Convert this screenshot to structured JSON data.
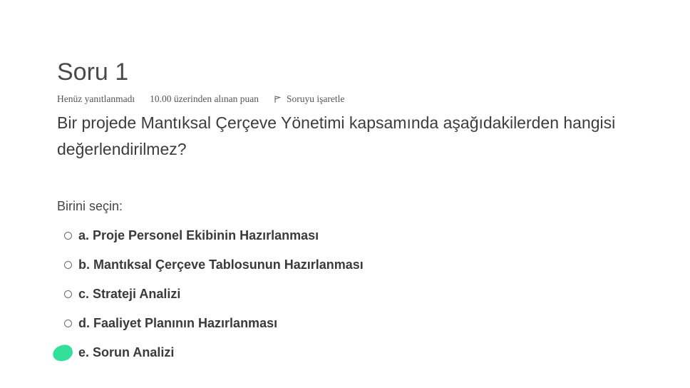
{
  "question": {
    "title": "Soru 1",
    "state": "Henüz yanıtlanmadı",
    "grade": "10.00 üzerinden alınan puan",
    "flag_label": "Soruyu işaretle",
    "text": "Bir projede Mantıksal Çerçeve Yönetimi kapsamında aşağıdakilerden hangisi değerlendirilmez?",
    "prompt": "Birini seçin:",
    "options": [
      {
        "label": "a. Proje Personel Ekibinin Hazırlanması",
        "selected": false
      },
      {
        "label": "b. Mantıksal Çerçeve Tablosunun Hazırlanması",
        "selected": false
      },
      {
        "label": "c. Strateji Analizi",
        "selected": false
      },
      {
        "label": "d. Faaliyet Planının Hazırlanması",
        "selected": false
      },
      {
        "label": "e. Sorun Analizi",
        "selected": false
      }
    ]
  },
  "colors": {
    "highlight": "#33e09a",
    "text": "#3a3a3a"
  },
  "icons": {
    "flag": "flag-icon",
    "radio": "radio-circle-icon"
  }
}
